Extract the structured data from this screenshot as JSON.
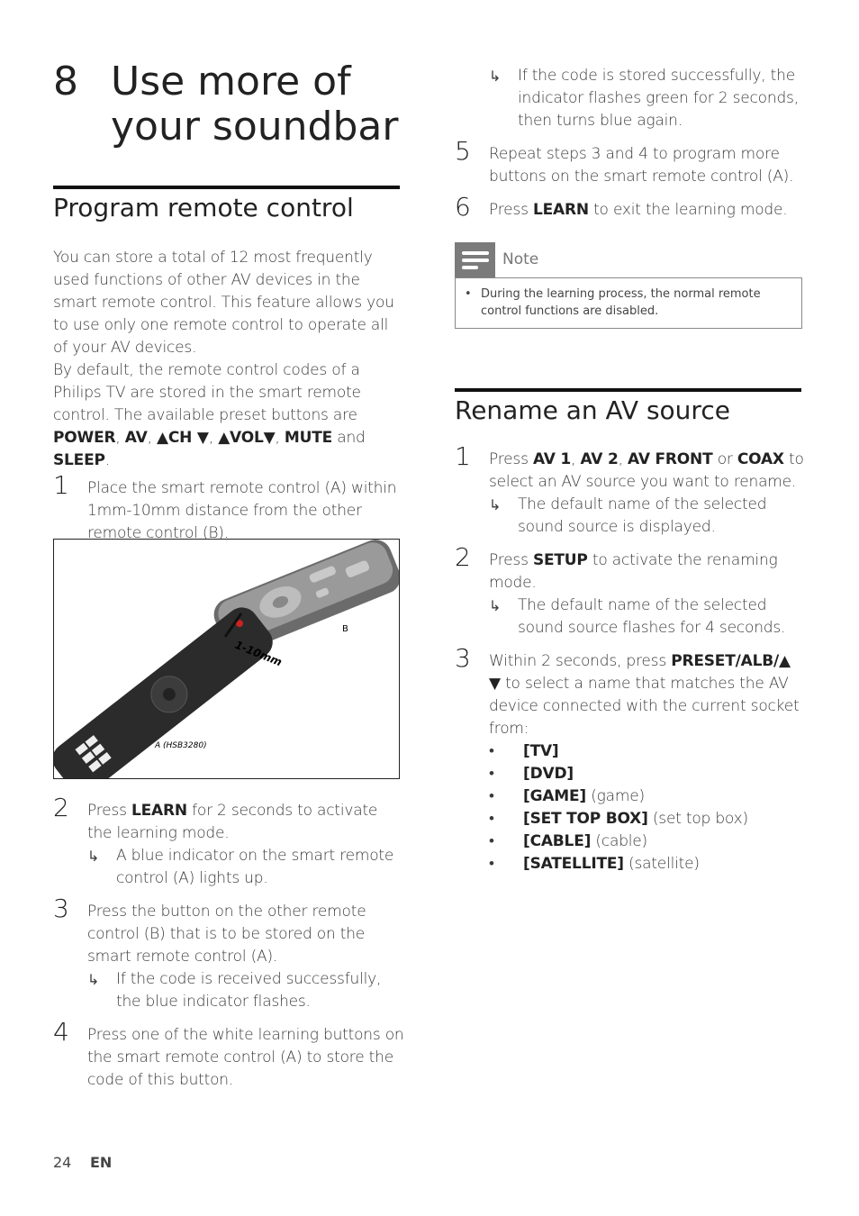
{
  "chapter": {
    "number": "8",
    "title": "Use more of your soundbar"
  },
  "section1": {
    "heading": "Program remote control",
    "intro": [
      [
        "You can store a total of 12 most frequently used functions of other AV devices in the smart remote control. This feature allows you to use only one remote control to operate all of your AV devices.",
        0
      ]
    ],
    "intro2": [
      [
        "By default, the remote control codes of a Philips TV are stored in the smart remote control. The available preset buttons are ",
        0
      ],
      [
        "POWER",
        1
      ],
      [
        ", ",
        0
      ],
      [
        "AV",
        1
      ],
      [
        ", ",
        0
      ],
      [
        "▲CH ▼",
        1
      ],
      [
        ", ",
        0
      ],
      [
        "▲VOL▼",
        1
      ],
      [
        ", ",
        0
      ],
      [
        "MUTE",
        1
      ],
      [
        " and ",
        0
      ],
      [
        "SLEEP",
        1
      ],
      [
        ".",
        0
      ]
    ],
    "step1": {
      "n": "1",
      "text": [
        [
          "Place the smart remote control (A) within 1mm-10mm distance from the other remote control (B).",
          0
        ]
      ]
    },
    "figure": {
      "label_b": "B",
      "distance": "1-10mm",
      "label_a": "A (HSB3280)"
    },
    "steps": [
      {
        "n": "2",
        "text": [
          [
            "Press ",
            0
          ],
          [
            "LEARN",
            1
          ],
          [
            " for 2 seconds to activate the learning mode.",
            0
          ]
        ],
        "result": "A blue indicator on the smart remote control (A) lights up."
      },
      {
        "n": "3",
        "text": [
          [
            "Press the button on the other remote control (B) that is to be stored on the smart remote control (A).",
            0
          ]
        ],
        "result": "If the code is received successfully, the blue indicator flashes."
      },
      {
        "n": "4",
        "text": [
          [
            "Press one of the white learning buttons on the smart remote control (A) to store the code of this button.",
            0
          ]
        ]
      }
    ]
  },
  "col2": {
    "cont_result": "If the code is stored successfully, the indicator flashes green for 2 seconds, then turns blue again.",
    "steps": [
      {
        "n": "5",
        "text": [
          [
            "Repeat steps 3 and 4 to program more buttons on the smart remote control (A).",
            0
          ]
        ]
      },
      {
        "n": "6",
        "text": [
          [
            "Press ",
            0
          ],
          [
            "LEARN",
            1
          ],
          [
            " to exit the learning mode.",
            0
          ]
        ]
      }
    ],
    "note": {
      "label": "Note",
      "text": "During the learning process, the normal remote control functions are disabled."
    }
  },
  "section2": {
    "heading": "Rename an AV source",
    "steps": [
      {
        "n": "1",
        "text": [
          [
            "Press ",
            0
          ],
          [
            "AV 1",
            1
          ],
          [
            ", ",
            0
          ],
          [
            "AV 2",
            1
          ],
          [
            ", ",
            0
          ],
          [
            "AV FRONT",
            1
          ],
          [
            " or ",
            0
          ],
          [
            "COAX",
            1
          ],
          [
            " to select an AV source you want to rename.",
            0
          ]
        ],
        "result": "The default name of the selected sound source is displayed."
      },
      {
        "n": "2",
        "text": [
          [
            "Press ",
            0
          ],
          [
            "SETUP",
            1
          ],
          [
            " to activate the renaming mode.",
            0
          ]
        ],
        "result": "The default name of the selected sound source flashes for 4 seconds."
      },
      {
        "n": "3",
        "text": [
          [
            "Within 2 seconds, press ",
            0
          ],
          [
            "PRESET/ALB/▲ ▼",
            1
          ],
          [
            " to select a name that matches the AV device connected with the current socket from:",
            0
          ]
        ]
      }
    ],
    "options": [
      [
        [
          "[TV]",
          1
        ]
      ],
      [
        [
          "[DVD]",
          1
        ]
      ],
      [
        [
          "[GAME]",
          1
        ],
        [
          " (game)",
          0
        ]
      ],
      [
        [
          "[SET TOP BOX]",
          1
        ],
        [
          " (set top box)",
          0
        ]
      ],
      [
        [
          "[CABLE]",
          1
        ],
        [
          " (cable)",
          0
        ]
      ],
      [
        [
          "[SATELLITE]",
          1
        ],
        [
          " (satellite)",
          0
        ]
      ]
    ]
  },
  "footer": {
    "page": "24",
    "lang": "EN"
  }
}
